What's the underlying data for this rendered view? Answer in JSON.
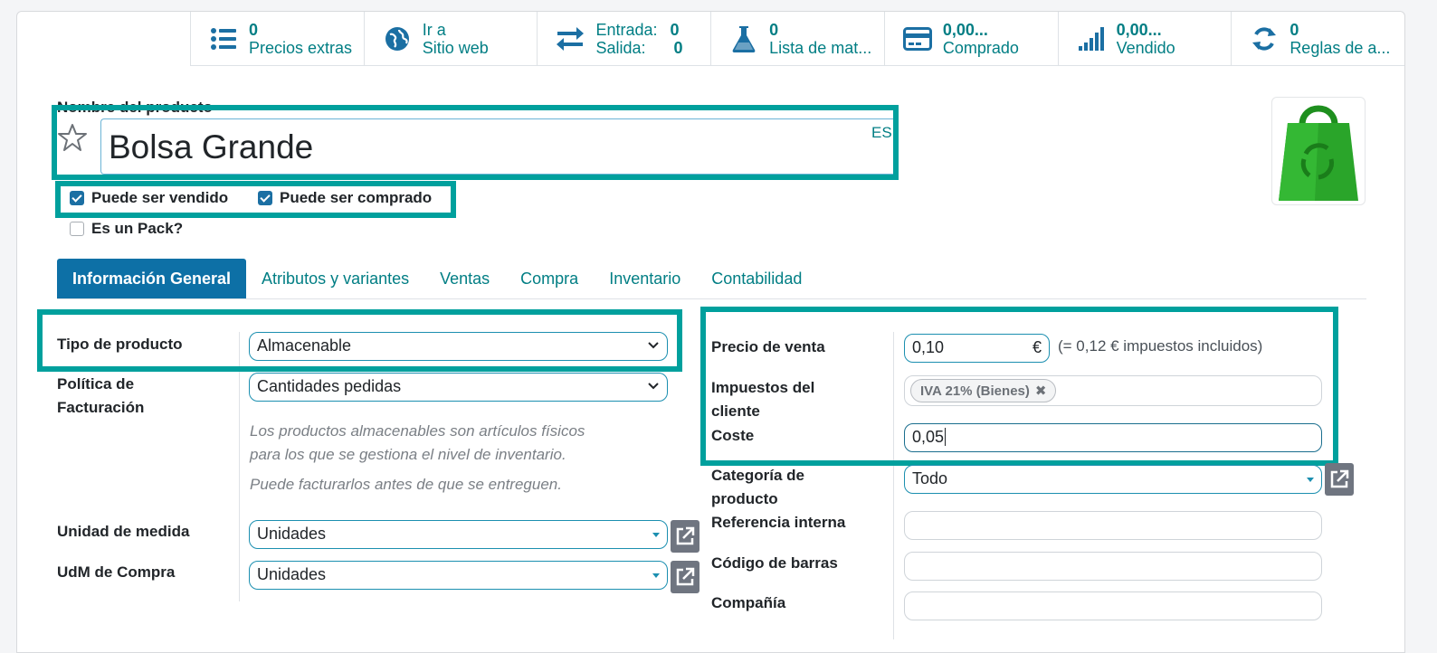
{
  "smart_buttons": [
    {
      "icon": "list-icon",
      "value": "0",
      "label": "Precios extras"
    },
    {
      "icon": "globe-icon",
      "value": "Ir a",
      "label": "Sitio web"
    },
    {
      "icon": "exchange-icon",
      "in_label": "Entrada:",
      "in_value": "0",
      "out_label": "Salida:",
      "out_value": "0"
    },
    {
      "icon": "flask-icon",
      "value": "0",
      "label": "Lista de mat..."
    },
    {
      "icon": "credit-card-icon",
      "value": "0,00...",
      "label": "Comprado"
    },
    {
      "icon": "signal-icon",
      "value": "0,00...",
      "label": "Vendido"
    },
    {
      "icon": "refresh-icon",
      "value": "0",
      "label": "Reglas de a..."
    }
  ],
  "product": {
    "name_label": "Nombre del producto",
    "name": "Bolsa Grande",
    "lang": "ES",
    "can_be_sold": "Puede ser vendido",
    "can_be_purchased": "Puede ser comprado",
    "is_pack": "Es un Pack?"
  },
  "tabs": [
    "Información General",
    "Atributos y variantes",
    "Ventas",
    "Compra",
    "Inventario",
    "Contabilidad"
  ],
  "left": {
    "product_type_label": "Tipo de producto",
    "product_type": "Almacenable",
    "invoice_policy_label_1": "Política de",
    "invoice_policy_label_2": "Facturación",
    "invoice_policy": "Cantidades pedidas",
    "help_1": "Los productos almacenables son artículos físicos",
    "help_2": "para los que se gestiona el nivel de inventario.",
    "help_3": "Puede facturarlos antes de que se entreguen.",
    "uom_label": "Unidad de medida",
    "uom": "Unidades",
    "uom_po_label": "UdM de Compra",
    "uom_po": "Unidades"
  },
  "right": {
    "sale_price_label": "Precio de venta",
    "sale_price": "0,10",
    "currency": "€",
    "tax_included_note": "(= 0,12 € impuestos incluidos)",
    "taxes_label_1": "Impuestos del",
    "taxes_label_2": "cliente",
    "tax_tag": "IVA 21% (Bienes)",
    "cost_label": "Coste",
    "cost": "0,05",
    "category_label_1": "Categoría de",
    "category_label_2": "producto",
    "category": "Todo",
    "internal_ref_label": "Referencia interna",
    "internal_ref": "",
    "barcode_label": "Código de barras",
    "barcode": "",
    "company_label": "Compañía",
    "company": ""
  },
  "colors": {
    "accent": "#017e84",
    "highlight": "#00a09d",
    "tab_active": "#0d70a6"
  }
}
